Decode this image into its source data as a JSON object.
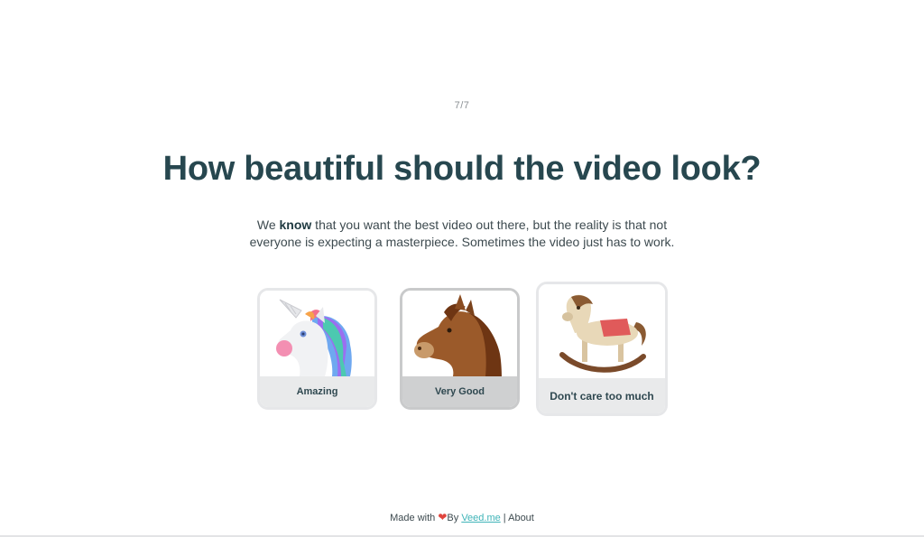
{
  "progress": {
    "step_label": "7/7"
  },
  "question": {
    "title": "How beautiful should the video look?",
    "desc_prefix": "We ",
    "desc_bold": "know",
    "desc_rest": " that you want the best video out there, but the reality is that not everyone is expecting a masterpiece. Sometimes the video just has to work."
  },
  "options": [
    {
      "label": "Amazing",
      "icon": "unicorn-icon"
    },
    {
      "label": "Very Good",
      "icon": "horse-icon"
    },
    {
      "label": "Don't care too much",
      "icon": "rocking-horse-icon"
    }
  ],
  "footer": {
    "made_with": "Made with",
    "heart_icon": "heart-icon",
    "by": "By",
    "brand_link": "Veed.me",
    "separator": "|",
    "about_link": "About"
  },
  "colors": {
    "title": "#27474f",
    "link": "#3fb4b8",
    "heart": "#e0453e"
  }
}
